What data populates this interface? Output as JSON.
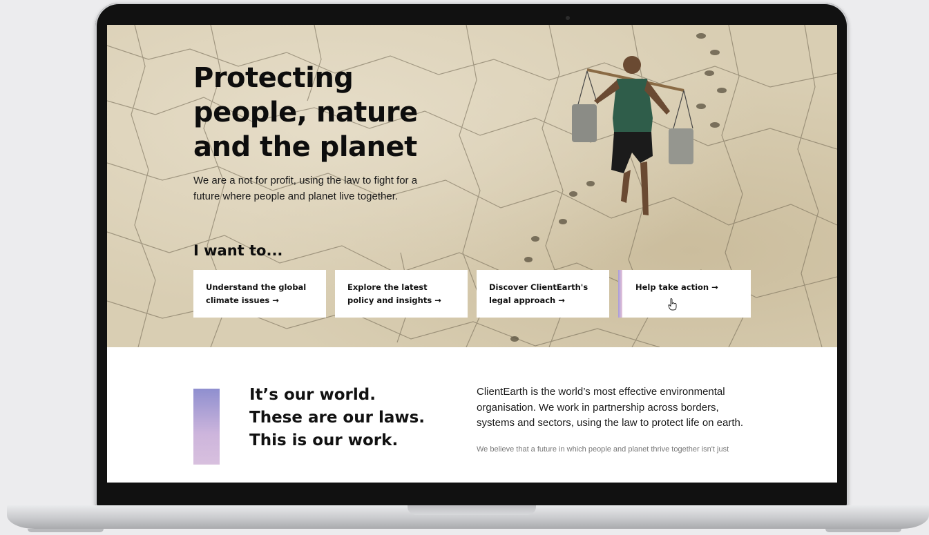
{
  "hero": {
    "title_lines": [
      "Protecting",
      "people, nature",
      "and the planet"
    ],
    "subtitle": "We are a not for profit, using the law to fight for a future where people and planet live together.",
    "prompt": "I want to..."
  },
  "cards": [
    {
      "label": "Understand the global climate issues →"
    },
    {
      "label": "Explore the latest policy and insights →"
    },
    {
      "label": "Discover ClientEarth's  legal approach →"
    },
    {
      "label": "Help take action →"
    }
  ],
  "about": {
    "tagline_lines": [
      "It’s our world.",
      "These are our laws.",
      "This is our work."
    ],
    "lead": "ClientEarth is the world’s most effective environmental organisation. We work in partnership across borders, systems and sectors, using the law to protect life on earth.",
    "body": "We believe that a future in which people and planet thrive together isn't just"
  },
  "colors": {
    "accent_gradient_top": "#8f8fcf",
    "accent_gradient_bottom": "#d8c0de",
    "hero_ground": "#d9ceb3"
  },
  "icons": {
    "cursor": "hand-pointer-icon"
  }
}
